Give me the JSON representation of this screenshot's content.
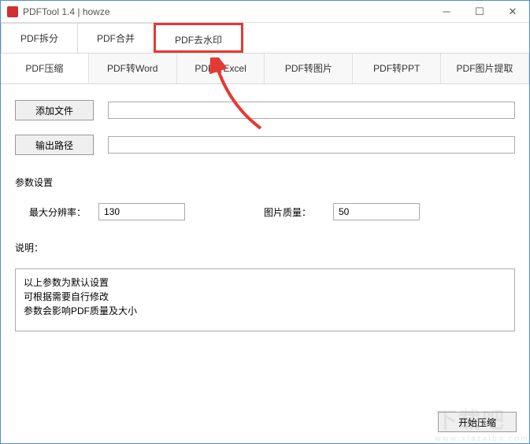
{
  "window": {
    "title": "PDFTool 1.4 | howze"
  },
  "tabs_top": {
    "split": "PDF拆分",
    "merge": "PDF合并",
    "watermark": "PDF去水印"
  },
  "tabs_sub": {
    "compress": "PDF压缩",
    "word": "PDF转Word",
    "excel": "PDF转Excel",
    "image": "PDF转图片",
    "ppt": "PDF转PPT",
    "extract": "PDF图片提取"
  },
  "buttons": {
    "add_file": "添加文件",
    "output_path": "输出路径",
    "start": "开始压缩"
  },
  "labels": {
    "params": "参数设置",
    "max_res": "最大分辨率：",
    "img_quality": "图片质量：",
    "desc_header": "说明："
  },
  "values": {
    "max_res": "130",
    "img_quality": "50"
  },
  "desc": {
    "line1": "以上参数为默认设置",
    "line2": "可根据需要自行修改",
    "line3": "参数会影响PDF质量及大小"
  },
  "watermark": {
    "big": "下载吧",
    "small": "www.xiazaiba.com"
  }
}
